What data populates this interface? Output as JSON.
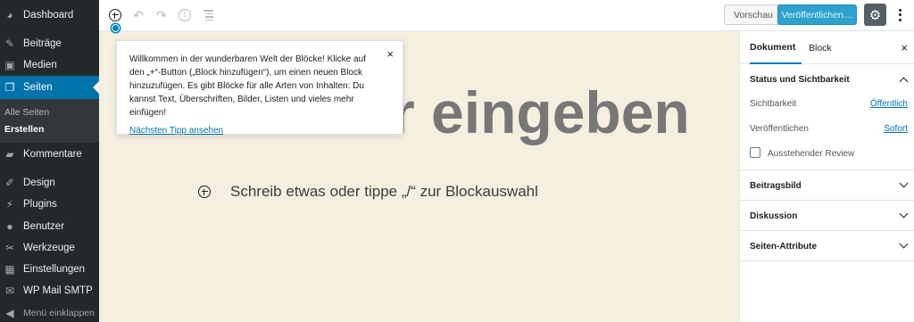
{
  "admin_menu": {
    "items": [
      {
        "label": "Dashboard",
        "icon": "dashboard-icon"
      },
      {
        "label": "Beiträge",
        "icon": "pin-icon"
      },
      {
        "label": "Medien",
        "icon": "media-icon"
      },
      {
        "label": "Seiten",
        "icon": "pages-icon"
      },
      {
        "label": "Kommentare",
        "icon": "comments-icon"
      },
      {
        "label": "Design",
        "icon": "brush-icon"
      },
      {
        "label": "Plugins",
        "icon": "plugin-icon"
      },
      {
        "label": "Benutzer",
        "icon": "user-icon"
      },
      {
        "label": "Werkzeuge",
        "icon": "wrench-icon"
      },
      {
        "label": "Einstellungen",
        "icon": "settings-icon"
      },
      {
        "label": "WP Mail SMTP",
        "icon": "mail-icon"
      }
    ],
    "submenu": [
      "Alle Seiten",
      "Erstellen"
    ],
    "collapse_label": "Menü einklappen"
  },
  "toolbar": {
    "preview_label": "Vorschau",
    "publish_label": "Veröffentlichen…"
  },
  "tip": {
    "text": "Willkommen in der wunderbaren Welt der Blöcke! Klicke auf den „+“-Button („Block hinzufügen“), um einen neuen Block hinzuzufügen. Es gibt Blöcke für alle Arten von Inhalten: Du kannst Text, Überschriften, Bilder, Listen und vieles mehr einfügen!",
    "link": "Nächsten Tipp ansehen",
    "close": "×"
  },
  "content": {
    "title_visible": "r eingeben",
    "paragraph_placeholder": "Schreib etwas oder tippe „/“ zur Blockauswahl"
  },
  "sidebar": {
    "tabs": [
      "Dokument",
      "Block"
    ],
    "close": "×",
    "status_panel": {
      "title": "Status und Sichtbarkeit",
      "visibility_label": "Sichtbarkeit",
      "visibility_value": "Öffentlich",
      "publish_label": "Veröffentlichen",
      "publish_value": "Sofort",
      "pending_review_label": "Ausstehender Review"
    },
    "panels": [
      "Beitragsbild",
      "Diskussion",
      "Seiten-Attribute"
    ]
  },
  "colors": {
    "admin_bg": "#23282d",
    "admin_active": "#0073aa",
    "publish_bg": "#2ea2cc",
    "canvas_bg": "#f5efe0",
    "link": "#0073aa"
  }
}
